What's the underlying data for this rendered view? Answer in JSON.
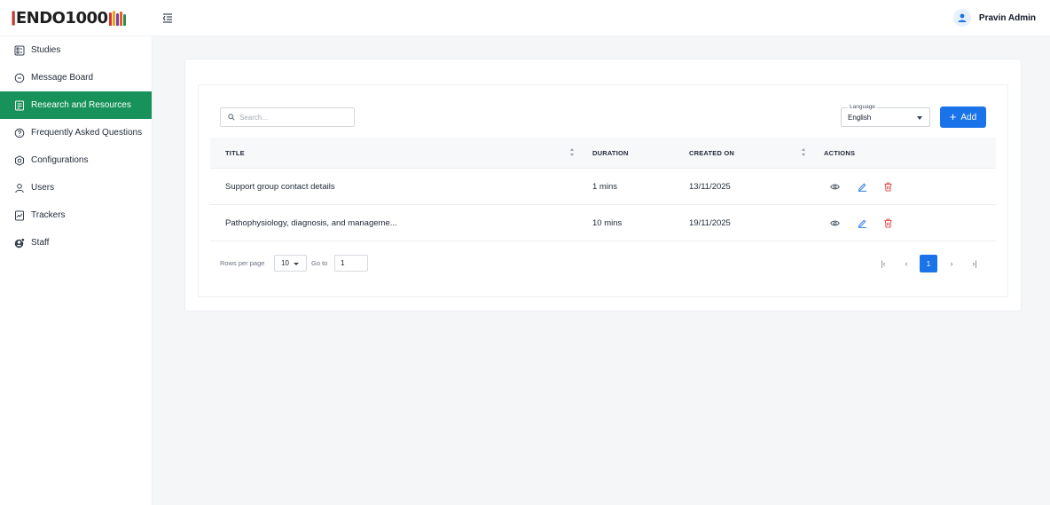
{
  "brand": {
    "logo_text": "ENDO1000"
  },
  "header": {
    "user_name": "Pravin Admin"
  },
  "sidebar": {
    "items": [
      {
        "label": "Studies",
        "icon": "studies-icon"
      },
      {
        "label": "Message Board",
        "icon": "message-icon"
      },
      {
        "label": "Research and Resources",
        "icon": "resources-icon",
        "active": true
      },
      {
        "label": "Frequently Asked Questions",
        "icon": "question-icon"
      },
      {
        "label": "Configurations",
        "icon": "gear-icon"
      },
      {
        "label": "Users",
        "icon": "user-icon"
      },
      {
        "label": "Trackers",
        "icon": "tracker-icon"
      },
      {
        "label": "Staff",
        "icon": "staff-icon"
      }
    ]
  },
  "toolbar": {
    "search_placeholder": "Search...",
    "language_label": "Language",
    "language_value": "English",
    "add_label": "Add"
  },
  "table": {
    "columns": [
      "TITLE",
      "DURATION",
      "CREATED ON",
      "ACTIONS"
    ],
    "rows": [
      {
        "title": "Support group contact details",
        "duration": "1 mins",
        "created_on": "13/11/2025"
      },
      {
        "title": "Pathophysiology, diagnosis, and manageme...",
        "duration": "10 mins",
        "created_on": "19/11/2025"
      }
    ]
  },
  "pagination": {
    "rows_per_page_label": "Rows per page",
    "rows_per_page_value": "10",
    "goto_label": "Go to",
    "goto_value": "1",
    "current_page": "1",
    "first_glyph": "|‹",
    "prev_glyph": "‹",
    "next_glyph": "›",
    "last_glyph": "›|"
  },
  "colors": {
    "accent": "#17925a",
    "primary": "#1a73e8",
    "danger": "#e04848"
  }
}
